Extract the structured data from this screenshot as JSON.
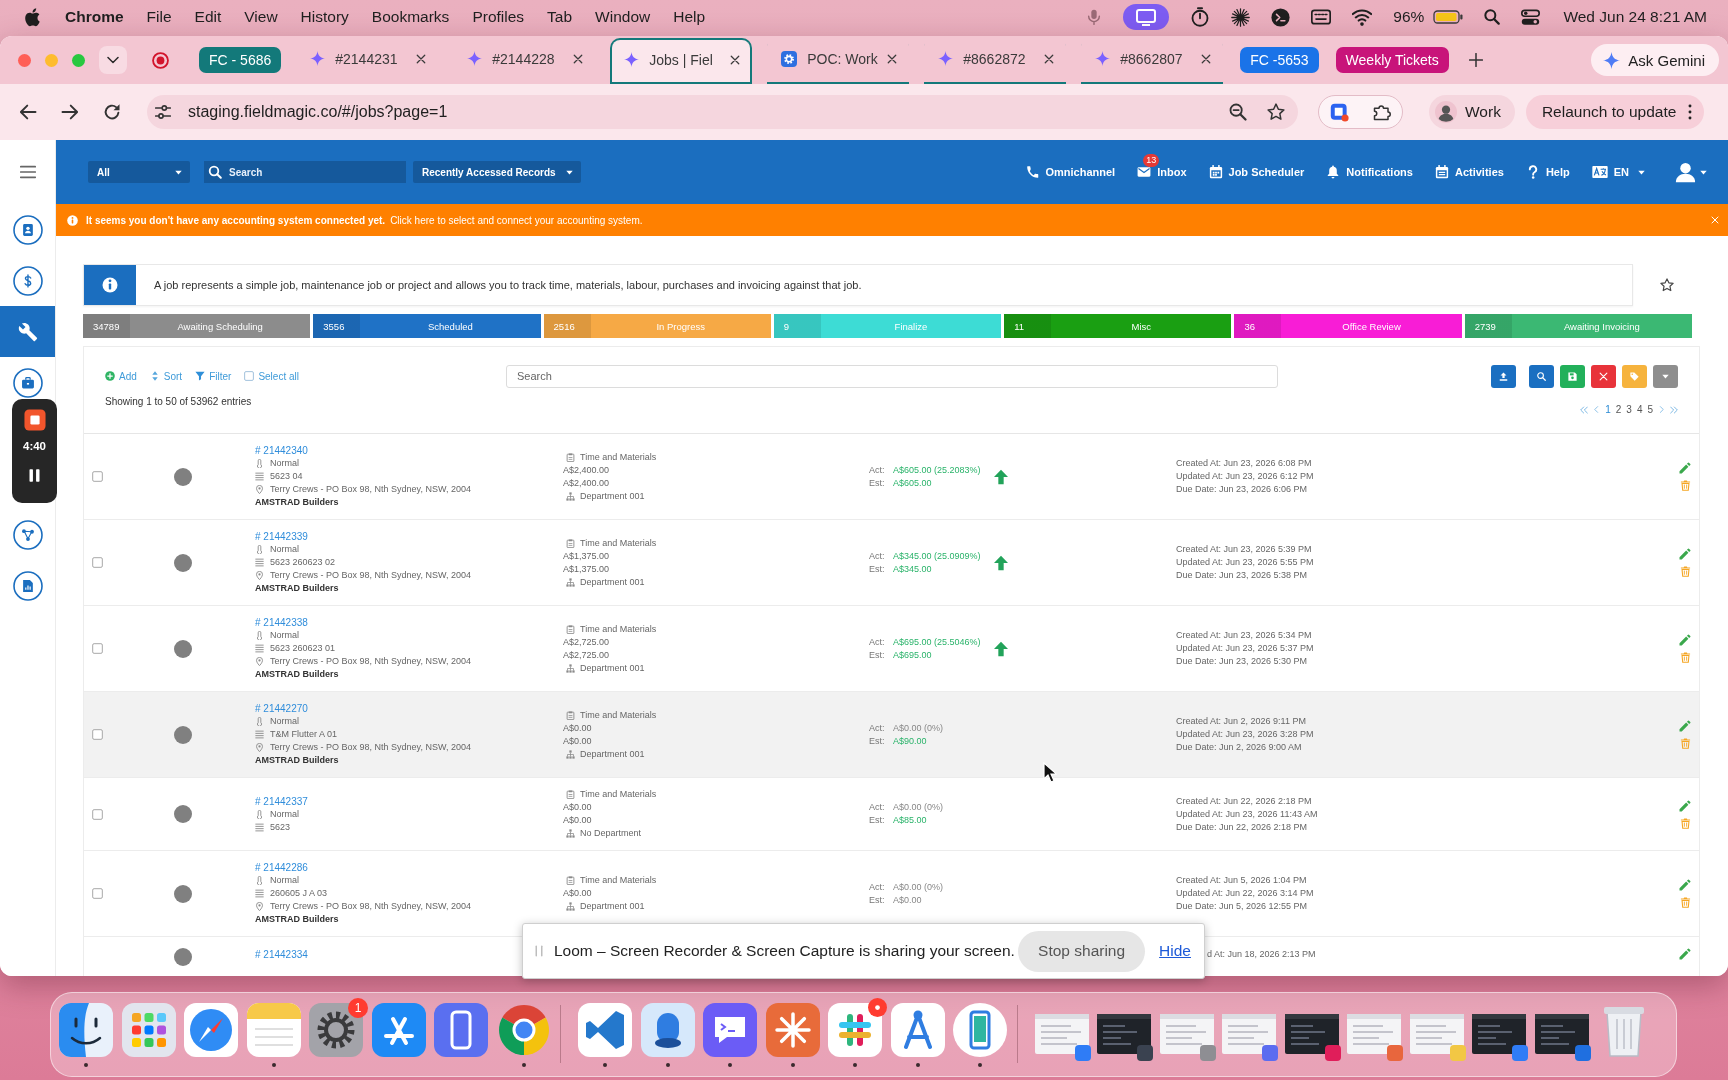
{
  "menu_bar": {
    "app_name": "Chrome",
    "menus": [
      "File",
      "Edit",
      "View",
      "History",
      "Bookmarks",
      "Profiles",
      "Tab",
      "Window",
      "Help"
    ],
    "battery": "96%",
    "clock": "Wed Jun 24 8:21 AM"
  },
  "browser": {
    "tabs": [
      {
        "kind": "group",
        "label": "FC - 5686",
        "color": "#13797a",
        "selected": false,
        "underlined": false
      },
      {
        "kind": "tab",
        "favicon": {
          "kind": "sparkle"
        },
        "label": "#2144231",
        "selected": false,
        "underlined": false
      },
      {
        "kind": "tab",
        "favicon": {
          "kind": "sparkle"
        },
        "label": "#2144228",
        "selected": false,
        "underlined": false
      },
      {
        "kind": "tab",
        "favicon": {
          "kind": "sparkle"
        },
        "label": "Jobs | Fiel",
        "selected": true,
        "underlined": true
      },
      {
        "kind": "tab",
        "favicon": {
          "kind": "gear"
        },
        "label": "POC: Work",
        "selected": false,
        "underlined": true
      },
      {
        "kind": "tab",
        "favicon": {
          "kind": "sparkle"
        },
        "label": "#8662872",
        "selected": false,
        "underlined": true
      },
      {
        "kind": "tab",
        "favicon": {
          "kind": "sparkle"
        },
        "label": "#8662807",
        "selected": false,
        "underlined": true
      },
      {
        "kind": "group",
        "label": "FC -5653",
        "color": "#1a73e8",
        "selected": false,
        "underlined": false
      },
      {
        "kind": "group",
        "label": "Weekly Tickets",
        "color": "#c8147a",
        "selected": false,
        "underlined": false
      }
    ],
    "gemini_button": "Ask Gemini",
    "url": "staging.fieldmagic.co/#/jobs?page=1",
    "profile": "Work",
    "update_button": "Relaunch to update"
  },
  "sidebar": {
    "top_items": [
      {
        "kind": "contacts",
        "selected": false
      },
      {
        "kind": "billing",
        "selected": false
      },
      {
        "kind": "jobs",
        "selected": true
      },
      {
        "kind": "assets",
        "selected": false
      }
    ],
    "bottom_items": [
      {
        "kind": "workflow",
        "selected": false
      },
      {
        "kind": "reports",
        "selected": false
      }
    ]
  },
  "recorder": {
    "timer": "4:40"
  },
  "header": {
    "scope": "All",
    "search_placeholder": "Search",
    "recent": "Recently Accessed Records",
    "links": [
      {
        "kind": "phone",
        "label": "Omnichannel"
      },
      {
        "kind": "mail",
        "label": "Inbox",
        "badge": "13"
      },
      {
        "kind": "calendar",
        "label": "Job Scheduler"
      },
      {
        "kind": "bell",
        "label": "Notifications"
      },
      {
        "kind": "agenda",
        "label": "Activities"
      },
      {
        "kind": "help",
        "label": "Help"
      },
      {
        "kind": "language",
        "label": "EN"
      }
    ]
  },
  "alert": {
    "message": "It seems you don't have any accounting system connected yet.",
    "link": "Click here to select and connect your accounting system."
  },
  "intro": "A job represents a simple job, maintenance job or project and allows you to track time, materials, labour, purchases and invoicing against that job.",
  "status_tabs": [
    {
      "count": "34789",
      "label": "Awaiting Scheduling",
      "color": "#8c8c8c"
    },
    {
      "count": "3556",
      "label": "Scheduled",
      "color": "#1f72c6"
    },
    {
      "count": "2516",
      "label": "In Progress",
      "color": "#f6a945"
    },
    {
      "count": "9",
      "label": "Finalize",
      "color": "#3ddcd5"
    },
    {
      "count": "11",
      "label": "Misc",
      "color": "#1a9f12"
    },
    {
      "count": "36",
      "label": "Office Review",
      "color": "#f81dd6"
    },
    {
      "count": "2739",
      "label": "Awaiting Invoicing",
      "color": "#3bb873"
    }
  ],
  "toolbar": {
    "actions": [
      {
        "kind": "add",
        "label": "Add"
      },
      {
        "kind": "sort",
        "label": "Sort"
      },
      {
        "kind": "filter",
        "label": "Filter"
      },
      {
        "kind": "select",
        "label": "Select all"
      }
    ],
    "search_placeholder": "Search",
    "buttons": [
      {
        "kind": "upload",
        "color": "#1a6fc1"
      },
      {
        "kind": "search",
        "color": "#1a6fc1"
      },
      {
        "kind": "save",
        "color": "#22b05a"
      },
      {
        "kind": "delete",
        "color": "#e8333a"
      },
      {
        "kind": "tag",
        "color": "#f6b33d"
      },
      {
        "kind": "more",
        "color": "#8e8e8e"
      }
    ]
  },
  "entries_info": "Showing 1 to 50 of 53962 entries",
  "pagination": [
    {
      "label": "1",
      "selected": true
    },
    {
      "label": "2",
      "selected": false
    },
    {
      "label": "3",
      "selected": false
    },
    {
      "label": "4",
      "selected": false
    },
    {
      "label": "5",
      "selected": false
    }
  ],
  "rows": [
    {
      "kind": "job",
      "checked": false,
      "hovered": false,
      "id": "# 21442340",
      "priority": "Normal",
      "reference": "5623 04",
      "address": "Terry Crews - PO Box 98, Nth Sydney, NSW, 2004",
      "customer": "AMSTRAD Builders",
      "type": "Time and Materials",
      "amounts": [
        "A$2,400.00",
        "A$2,400.00"
      ],
      "department": "Department 001",
      "actual": {
        "label": "Act:",
        "value": "A$605.00 (25.2083%)",
        "positive": true
      },
      "estimate": {
        "label": "Est:",
        "value": "A$605.00",
        "positive": true
      },
      "rising": true,
      "dates": [
        "Created At: Jun 23, 2026 6:08 PM",
        "Updated At: Jun 23, 2026 6:12 PM",
        "Due Date: Jun 23, 2026 6:06 PM"
      ]
    },
    {
      "kind": "job",
      "checked": false,
      "hovered": false,
      "id": "# 21442339",
      "priority": "Normal",
      "reference": "5623 260623 02",
      "address": "Terry Crews - PO Box 98, Nth Sydney, NSW, 2004",
      "customer": "AMSTRAD Builders",
      "type": "Time and Materials",
      "amounts": [
        "A$1,375.00",
        "A$1,375.00"
      ],
      "department": "Department 001",
      "actual": {
        "label": "Act:",
        "value": "A$345.00 (25.0909%)",
        "positive": true
      },
      "estimate": {
        "label": "Est:",
        "value": "A$345.00",
        "positive": true
      },
      "rising": true,
      "dates": [
        "Created At: Jun 23, 2026 5:39 PM",
        "Updated At: Jun 23, 2026 5:55 PM",
        "Due Date: Jun 23, 2026 5:38 PM"
      ]
    },
    {
      "kind": "job",
      "checked": false,
      "hovered": false,
      "id": "# 21442338",
      "priority": "Normal",
      "reference": "5623 260623 01",
      "address": "Terry Crews - PO Box 98, Nth Sydney, NSW, 2004",
      "customer": "AMSTRAD Builders",
      "type": "Time and Materials",
      "amounts": [
        "A$2,725.00",
        "A$2,725.00"
      ],
      "department": "Department 001",
      "actual": {
        "label": "Act:",
        "value": "A$695.00 (25.5046%)",
        "positive": true
      },
      "estimate": {
        "label": "Est:",
        "value": "A$695.00",
        "positive": true
      },
      "rising": true,
      "dates": [
        "Created At: Jun 23, 2026 5:34 PM",
        "Updated At: Jun 23, 2026 5:37 PM",
        "Due Date: Jun 23, 2026 5:30 PM"
      ]
    },
    {
      "kind": "job",
      "checked": false,
      "hovered": true,
      "id": "# 21442270",
      "priority": "Normal",
      "reference": "T&M Flutter A 01",
      "address": "Terry Crews - PO Box 98, Nth Sydney, NSW, 2004",
      "customer": "AMSTRAD Builders",
      "type": "Time and Materials",
      "amounts": [
        "A$0.00",
        "A$0.00"
      ],
      "department": "Department 001",
      "actual": {
        "label": "Act:",
        "value": "A$0.00 (0%)",
        "positive": false
      },
      "estimate": {
        "label": "Est:",
        "value": "A$90.00",
        "positive": true
      },
      "rising": false,
      "dates": [
        "Created At: Jun 2, 2026 9:11 PM",
        "Updated At: Jun 23, 2026 3:28 PM",
        "Due Date: Jun 2, 2026 9:00 AM"
      ]
    },
    {
      "kind": "job",
      "checked": false,
      "hovered": false,
      "id": "# 21442337",
      "priority": "Normal",
      "reference": "5623",
      "type": "Time and Materials",
      "amounts": [
        "A$0.00",
        "A$0.00"
      ],
      "department": "No Department",
      "actual": {
        "label": "Act:",
        "value": "A$0.00 (0%)",
        "positive": false
      },
      "estimate": {
        "label": "Est:",
        "value": "A$85.00",
        "positive": true
      },
      "rising": false,
      "dates": [
        "Created At: Jun 22, 2026 2:18 PM",
        "Updated At: Jun 23, 2026 11:43 AM",
        "Due Date: Jun 22, 2026 2:18 PM"
      ]
    },
    {
      "kind": "job",
      "checked": false,
      "hovered": false,
      "id": "# 21442286",
      "priority": "Normal",
      "reference": "260605 J A 03",
      "address": "Terry Crews - PO Box 98, Nth Sydney, NSW, 2004",
      "customer": "AMSTRAD Builders",
      "type": "Time and Materials",
      "amounts": [
        "A$0.00"
      ],
      "department": "Department 001",
      "actual": {
        "label": "Act:",
        "value": "A$0.00 (0%)",
        "positive": false
      },
      "estimate": {
        "label": "Est:",
        "value": "A$0.00",
        "positive": false
      },
      "rising": false,
      "dates": [
        "Created At: Jun 5, 2026 1:04 PM",
        "Updated At: Jun 22, 2026 3:14 PM",
        "Due Date: Jun 5, 2026 12:55 PM"
      ]
    },
    {
      "kind": "cut_off",
      "hovered": false,
      "id": "# 21442334",
      "dates": [
        "d At: Jun 18, 2026 2:13 PM"
      ]
    }
  ],
  "share_bar": {
    "message": "Loom – Screen Recorder & Screen Capture is sharing your screen.",
    "stop_button": "Stop sharing",
    "hide_link": "Hide"
  },
  "dock": {
    "apps": [
      {
        "kind": "finder",
        "running": true,
        "notified": false
      },
      {
        "kind": "launchpad",
        "running": false,
        "notified": false
      },
      {
        "kind": "safari",
        "running": false,
        "notified": false
      },
      {
        "kind": "notes",
        "running": true,
        "notified": false
      },
      {
        "kind": "settings",
        "running": false,
        "notified": true,
        "badge": "1"
      },
      {
        "kind": "appstore",
        "running": false,
        "notified": false
      },
      {
        "kind": "simulator",
        "running": false,
        "notified": false
      },
      {
        "kind": "chrome",
        "running": true,
        "notified": false
      }
    ],
    "recent_apps": [
      {
        "kind": "vscode",
        "running": true,
        "notified": false
      },
      {
        "kind": "lens",
        "running": true,
        "notified": false
      },
      {
        "kind": "chat",
        "running": true,
        "notified": false
      },
      {
        "kind": "claude",
        "running": true,
        "notified": false
      },
      {
        "kind": "slack",
        "running": true,
        "notified": true
      },
      {
        "kind": "instruments",
        "running": true,
        "notified": false
      },
      {
        "kind": "device",
        "running": true,
        "notified": false
      }
    ],
    "windows": [
      {
        "kind": "light",
        "color": "#2f7cf6"
      },
      {
        "kind": "dark",
        "color": "#3a4250"
      },
      {
        "kind": "light",
        "color": "#8e8e93"
      },
      {
        "kind": "light",
        "color": "#5b6cf0"
      },
      {
        "kind": "dark",
        "color": "#e01e5a"
      },
      {
        "kind": "light",
        "color": "#e8663d"
      },
      {
        "kind": "light",
        "color": "#f2c744"
      },
      {
        "kind": "dark",
        "color": "#2f7cf6"
      },
      {
        "kind": "dark",
        "color": "#1f6fe0"
      }
    ]
  }
}
